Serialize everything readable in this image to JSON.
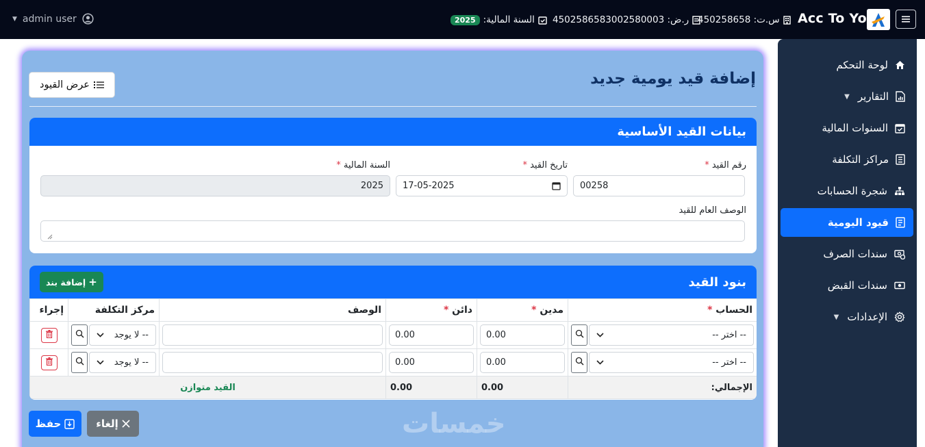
{
  "topbar": {
    "brand": "Acc To Yo",
    "tax_no": "س.ت: 450258658",
    "vat_no": "ر.ض: 450258658300258000​3",
    "fiscal_year_label": "السنة المالية:",
    "fiscal_year_badge": "2025",
    "user_name": "admin user"
  },
  "sidebar": {
    "items": [
      {
        "label": "لوحة التحكم",
        "icon": "home-icon"
      },
      {
        "label": "التقارير",
        "icon": "report-icon"
      },
      {
        "label": "السنوات المالية",
        "icon": "calendar-check-icon"
      },
      {
        "label": "مراكز التكلفة",
        "icon": "cost-center-icon"
      },
      {
        "label": "شجرة الحسابات",
        "icon": "tree-icon"
      },
      {
        "label": "قيود اليومية",
        "icon": "journal-icon"
      },
      {
        "label": "سندات الصرف",
        "icon": "payment-voucher-icon"
      },
      {
        "label": "سندات القبض",
        "icon": "receipt-voucher-icon"
      },
      {
        "label": "الإعدادات",
        "icon": "gear-icon"
      }
    ]
  },
  "page": {
    "title": "إضافة قيد يومية جديد",
    "view_button": "عرض القيود"
  },
  "basic": {
    "header": "بيانات القيد الأساسية",
    "entry_no_label": "رقم القيد",
    "entry_no_value": "00258",
    "date_label": "تاريخ القيد",
    "date_value": "17-05-2025",
    "year_label": "السنة المالية",
    "year_value": "2025",
    "desc_label": "الوصف العام للقيد",
    "req_mark": "*"
  },
  "lines": {
    "header": "بنود القيد",
    "add_button": "إضافة بند",
    "columns": {
      "account": "الحساب",
      "debit": "مدين",
      "credit": "دائن",
      "description": "الوصف",
      "cost_center": "مركز التكلفة",
      "action": "إجراء"
    },
    "rows": [
      {
        "account": "-- اختر --",
        "debit": "0.00",
        "credit": "0.00",
        "cost_center": "-- لا يوجد"
      },
      {
        "account": "-- اختر --",
        "debit": "0.00",
        "credit": "0.00",
        "cost_center": "-- لا يوجد"
      }
    ],
    "total_label": "الإجمالي:",
    "total_debit": "0.00",
    "total_credit": "0.00",
    "balance_status": "القيد متوازن"
  },
  "actions": {
    "save": "حفظ",
    "cancel": "إلغاء"
  },
  "watermark": "خمسات"
}
